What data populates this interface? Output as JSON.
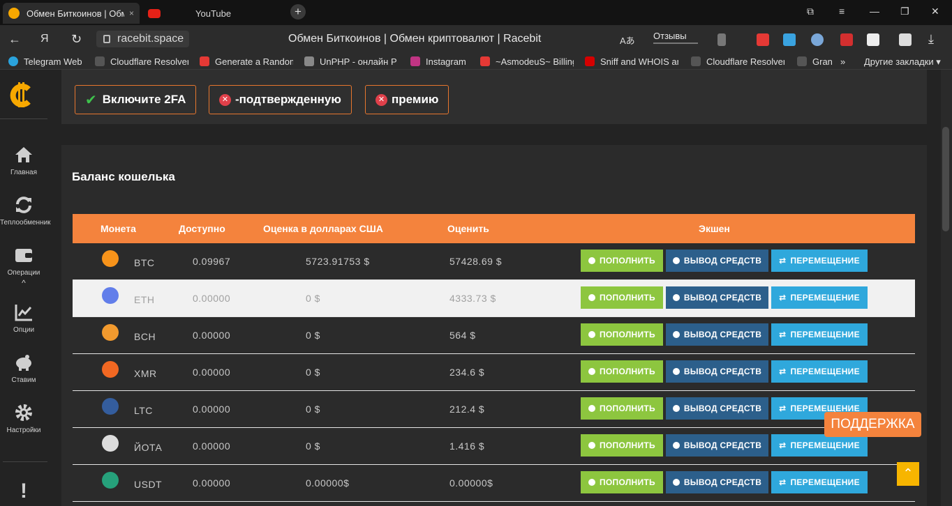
{
  "browser": {
    "tabs": [
      {
        "title": "Обмен Биткоинов | Обм",
        "favicon": "racebit-icon",
        "close": "×"
      },
      {
        "title": "YouTube",
        "favicon": "youtube-icon",
        "close": "×"
      }
    ],
    "new_tab": "+",
    "window_controls": {
      "minimize": "—",
      "maximize": "❐",
      "close": "✕",
      "menu": "≡",
      "collections": "⧉"
    },
    "nav": {
      "back": "←",
      "yandex": "Я",
      "reload": "↻"
    },
    "url": "racebit.space",
    "page_title": "Обмен Биткоинов | Обмен криптовалют | Racebit",
    "reviews": "Отзывы",
    "translate": "Aあ",
    "download": "⤓",
    "bookmarks": [
      {
        "label": "Telegram Web",
        "color": "#2aa3dd"
      },
      {
        "label": "Cloudflare Resolver",
        "color": "#555555"
      },
      {
        "label": "Generate a Random",
        "color": "#e53935"
      },
      {
        "label": "UnPHP - онлайн P",
        "color": "#888888"
      },
      {
        "label": "Instagram",
        "color": "#c13584"
      },
      {
        "label": "~AsmodeuS~ Billing",
        "color": "#e53935"
      },
      {
        "label": "Sniff and WHOIS an",
        "color": "#d50000"
      },
      {
        "label": "Cloudflare Resolver",
        "color": "#555555"
      },
      {
        "label": "Gran",
        "color": "#555555"
      }
    ],
    "more_bookmarks": "»",
    "other_bookmarks": "Другие закладки ▾"
  },
  "sidebar": {
    "items": [
      {
        "label": "Главная",
        "icon": "home-icon"
      },
      {
        "label": "Теплообменник",
        "icon": "exchange-icon"
      },
      {
        "label": "Операции",
        "icon": "wallet-icon"
      },
      {
        "label": "Опции",
        "icon": "chart-icon"
      },
      {
        "label": "Ставим",
        "icon": "piggy-bank-icon"
      },
      {
        "label": "Настройки",
        "icon": "gear-icon"
      }
    ],
    "collapse": "^",
    "alert": "!"
  },
  "verification": {
    "twofa": "Включите 2FA",
    "verified": "-подтвержденную",
    "premium": "премию"
  },
  "wallet": {
    "title": "Баланс кошелька",
    "columns": [
      "Монета",
      "Доступно",
      "Оценка в долларах США",
      "Оценить",
      "Экшен"
    ],
    "actions": {
      "deposit": "ПОПОЛНИТЬ",
      "withdraw": "ВЫВОД СРЕДСТВ",
      "move": "ПЕРЕМЕЩЕНИЕ"
    },
    "rows": [
      {
        "coin": "BTC",
        "icon": "bitcoin-icon",
        "available": "0.09967",
        "usd": "5723.91753 $",
        "rate": "57428.69 $"
      },
      {
        "coin": "ETH",
        "icon": "ethereum-icon",
        "available": "0.00000",
        "usd": "0 $",
        "rate": "4333.73 $"
      },
      {
        "coin": "BCH",
        "icon": "bitcoin-cash-icon",
        "available": "0.00000",
        "usd": "0 $",
        "rate": "564 $"
      },
      {
        "coin": "XMR",
        "icon": "monero-icon",
        "available": "0.00000",
        "usd": "0 $",
        "rate": "234.6 $"
      },
      {
        "coin": "LTC",
        "icon": "litecoin-icon",
        "available": "0.00000",
        "usd": "0 $",
        "rate": "212.4 $"
      },
      {
        "coin": "ЙОТА",
        "icon": "iota-icon",
        "available": "0.00000",
        "usd": "0 $",
        "rate": "1.416 $"
      },
      {
        "coin": "USDT",
        "icon": "tether-icon",
        "available": "0.00000",
        "usd": "0.00000$",
        "rate": "0.00000$"
      }
    ]
  },
  "support": "ПОДДЕРЖКА",
  "to_top": "⌃",
  "colors": {
    "accent": "#f4833d",
    "deposit": "#8dc63f",
    "withdraw": "#2c5f8b",
    "move": "#2fa8dc"
  }
}
